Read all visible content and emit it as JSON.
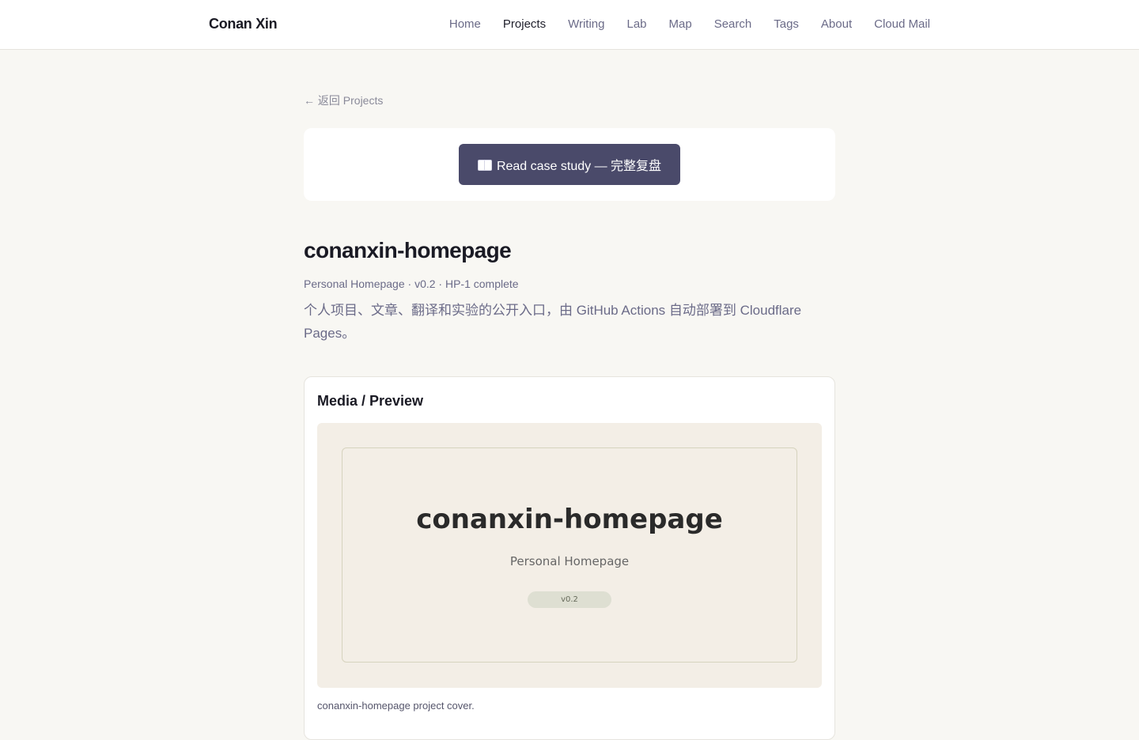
{
  "header": {
    "brand": "Conan Xin",
    "nav": [
      "Home",
      "Projects",
      "Writing",
      "Lab",
      "Map",
      "Search",
      "Tags",
      "About",
      "Cloud Mail"
    ],
    "active_nav": "Projects"
  },
  "back_link": "← 返回 Projects",
  "cta": {
    "icon": "book-icon",
    "label": "Read case study — 完整复盘"
  },
  "project": {
    "title": "conanxin-homepage",
    "meta": "Personal Homepage · v0.2 · HP-1 complete",
    "description": "个人项目、文章、翻译和实验的公开入口，由 GitHub Actions 自动部署到 Cloudflare Pages。"
  },
  "media": {
    "heading": "Media / Preview",
    "preview": {
      "title": "conanxin-homepage",
      "subtitle": "Personal Homepage",
      "badge": "v0.2"
    },
    "caption": "conanxin-homepage project cover."
  },
  "colors": {
    "background": "#f8f7f3",
    "accent_button": "#4a4a6a",
    "muted_text": "#6b6b88",
    "preview_bg": "#f3eee6"
  }
}
